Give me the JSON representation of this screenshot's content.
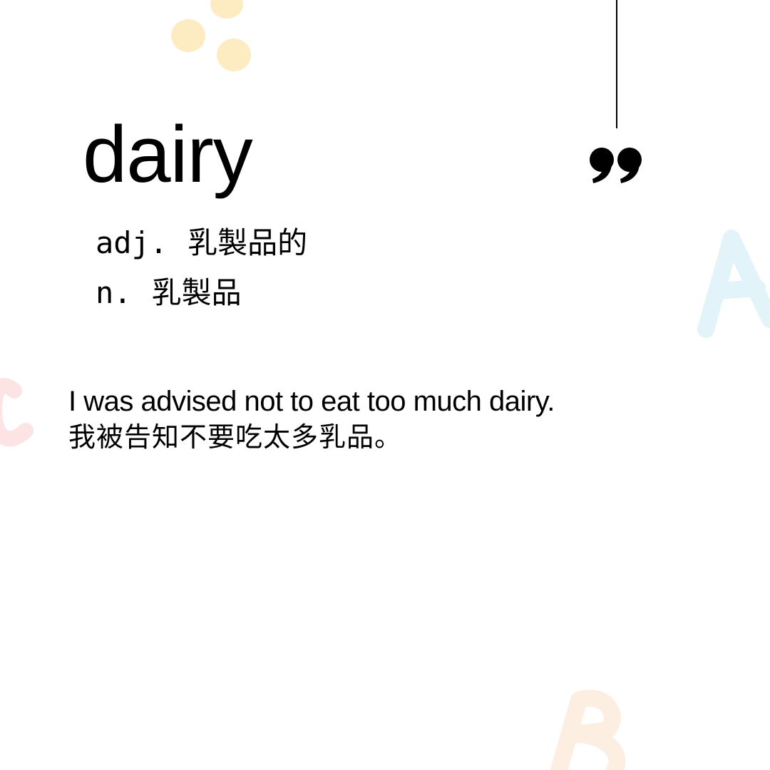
{
  "entry": {
    "word": "dairy",
    "definitions": [
      {
        "pos": "adj.",
        "meaning": "乳製品的"
      },
      {
        "pos": "n.",
        "meaning": "乳製品"
      }
    ]
  },
  "example": {
    "english": "I was advised not to eat too much dairy.",
    "chinese": "我被告知不要吃太多乳品。"
  },
  "icons": {
    "quote": "closing-quote-icon",
    "dots": "decorative-dots-icon",
    "letter_a": "letter-a-decoration",
    "letter_b": "letter-b-decoration",
    "letter_c": "letter-c-decoration"
  },
  "colors": {
    "background": "#ffffff",
    "text": "#000000",
    "dots": "#fdebc2",
    "letter_a": "#e3f3fa",
    "letter_b": "#fdeee2",
    "letter_c": "#fde4e4"
  }
}
